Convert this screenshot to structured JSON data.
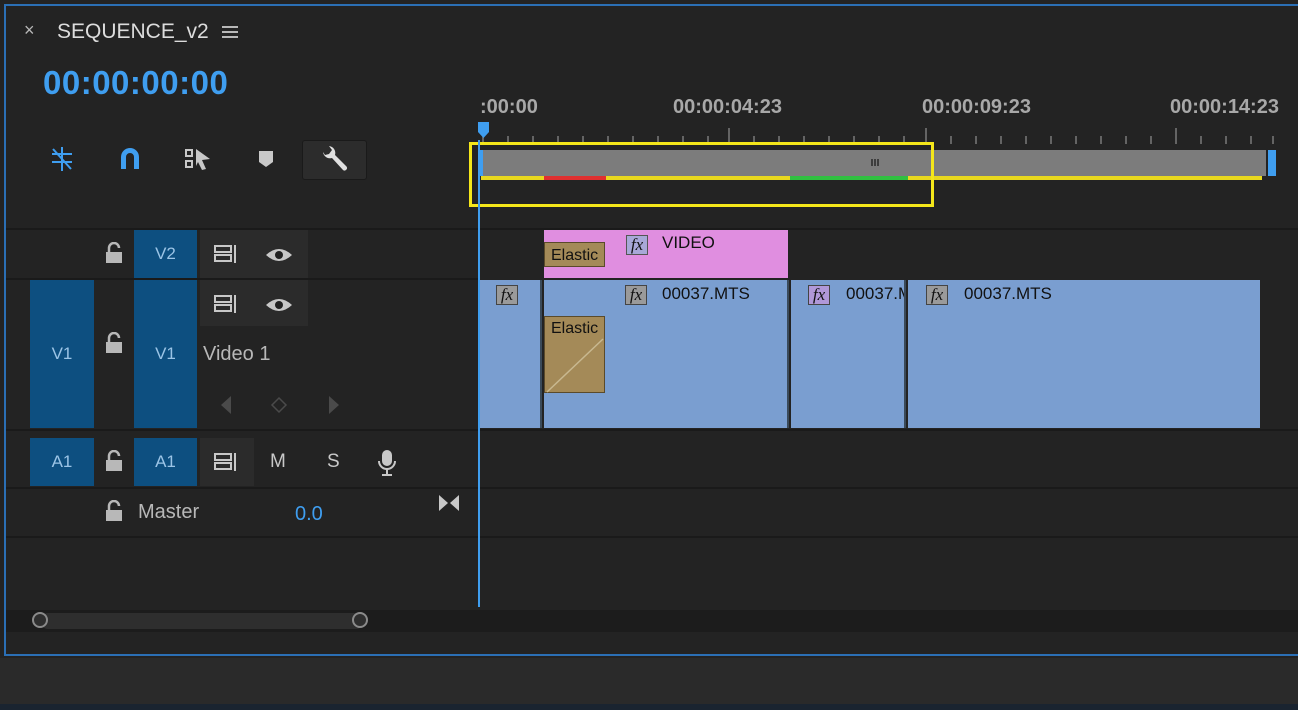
{
  "panel": {
    "close_glyph": "×",
    "sequence_name": "SEQUENCE_v2",
    "menu_icon": "hamburger-menu-icon",
    "timecode": "00:00:00:00"
  },
  "toolbar": {
    "tools": [
      "insert-nest-icon",
      "snap-magnet-icon",
      "linked-selection-icon",
      "add-marker-icon",
      "timeline-settings-wrench-icon"
    ],
    "accent": "#3f9ef0"
  },
  "ruler": {
    "labels": [
      ":00:00",
      "00:00:04:23",
      "00:00:09:23",
      "00:00:14:23"
    ]
  },
  "tracks": {
    "v2": {
      "target": "V2"
    },
    "v1": {
      "source": "V1",
      "target": "V1",
      "name": "Video 1"
    },
    "a1": {
      "source": "A1",
      "target": "A1",
      "mute": "M",
      "solo": "S"
    },
    "master": {
      "label": "Master",
      "value": "0.0"
    }
  },
  "clips": {
    "v2_clip": {
      "fx": "fx",
      "name": "VIDEO",
      "transition": "Elastic",
      "color": "#e08ee0"
    },
    "v1_clips": [
      {
        "fx": "fx",
        "name": ""
      },
      {
        "fx": "fx",
        "name": "00037.MTS"
      },
      {
        "fx": "fx",
        "name": "00037.M"
      },
      {
        "fx": "fx",
        "name": "00037.MTS"
      }
    ],
    "v1_transition": "Elastic",
    "v1_color": "#7a9ed0"
  },
  "highlight_color": "#f4e61a"
}
